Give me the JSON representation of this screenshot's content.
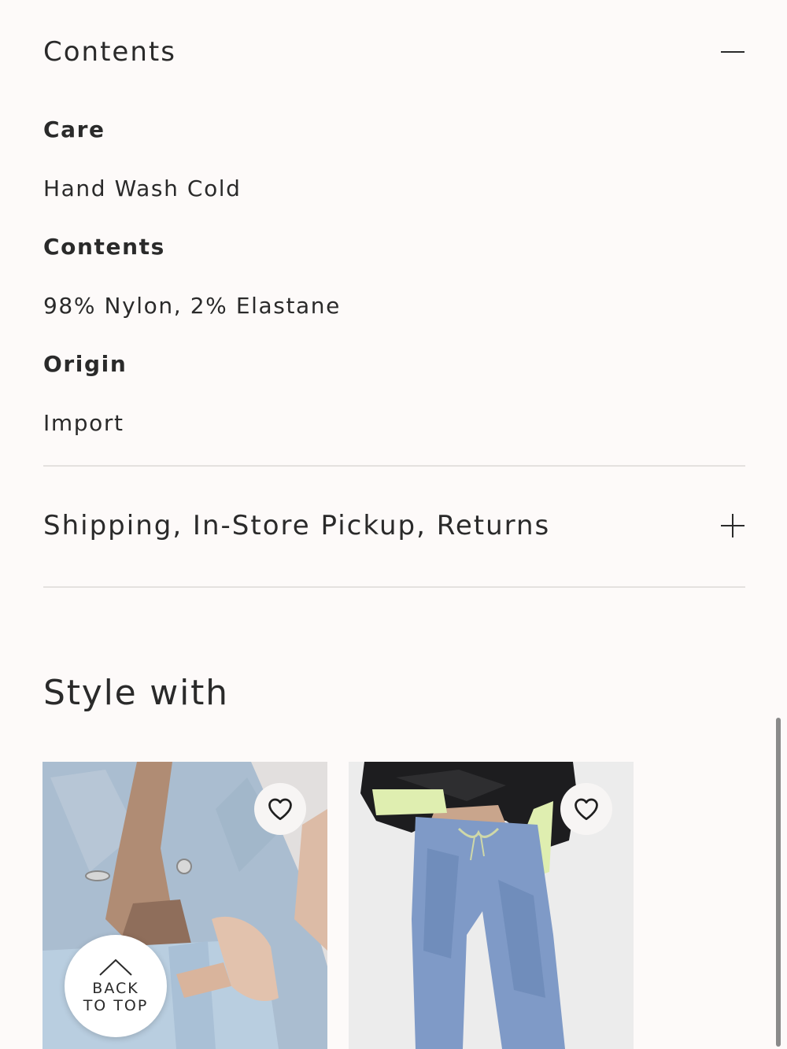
{
  "contents_section": {
    "title": "Contents",
    "toggle_icon": "minus-icon",
    "details": [
      {
        "label": "Care",
        "value": "Hand Wash Cold"
      },
      {
        "label": "Contents",
        "value": "98% Nylon, 2% Elastane"
      },
      {
        "label": "Origin",
        "value": "Import"
      }
    ]
  },
  "shipping_section": {
    "title": "Shipping, In-Store Pickup, Returns",
    "toggle_icon": "plus-icon"
  },
  "style_with": {
    "heading": "Style with",
    "products": [
      {
        "image": "denim-vest-and-jeans-photo",
        "favorite_icon": "heart-icon"
      },
      {
        "image": "black-jacket-and-blue-parachute-pants-photo",
        "favorite_icon": "heart-icon"
      }
    ]
  },
  "back_to_top": {
    "line1": "BACK",
    "line2": "TO TOP",
    "icon": "chevron-up-icon"
  },
  "colors": {
    "background": "#fdfaf9",
    "text": "#2a2a2a",
    "divider": "#e4e1df"
  }
}
